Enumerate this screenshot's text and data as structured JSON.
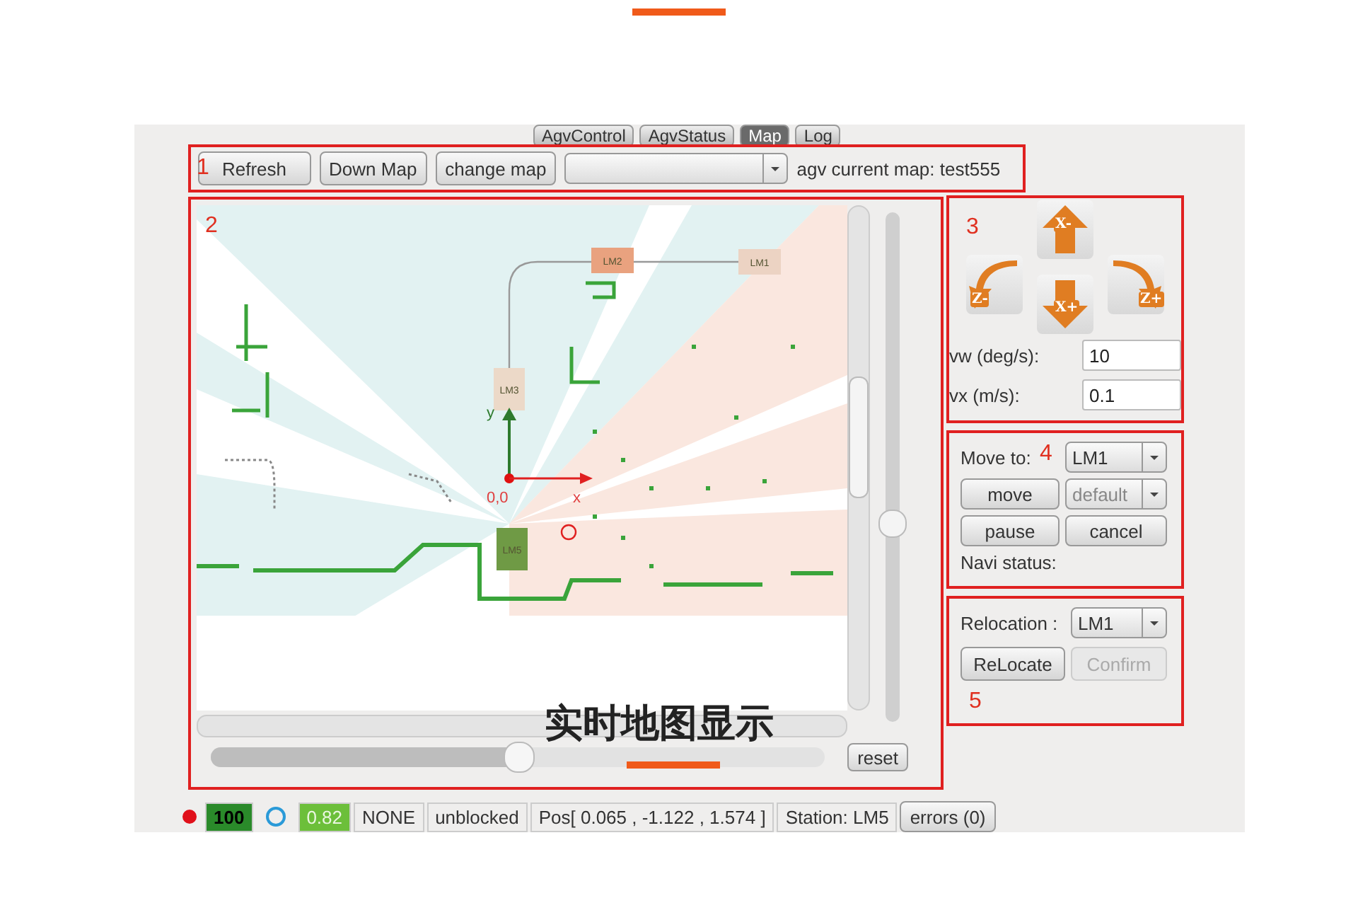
{
  "tabs": [
    {
      "label": "AgvControl",
      "selected": false
    },
    {
      "label": "AgvStatus",
      "selected": false
    },
    {
      "label": "Map",
      "selected": true
    },
    {
      "label": "Log",
      "selected": false
    }
  ],
  "toolbar": {
    "marker": "1",
    "buttons": [
      "Refresh",
      "Down Map",
      "change map"
    ],
    "current_map_label": "agv current map:",
    "current_map": "test555"
  },
  "map_view": {
    "marker": "2",
    "origin_label": "0,0",
    "x_axis": "x",
    "y_axis": "y",
    "landmarks": [
      {
        "label": "LM2",
        "color": "#e9a27f"
      },
      {
        "label": "LM1",
        "color": "#ecd3c3"
      },
      {
        "label": "LM3",
        "color": "#ecd9c8"
      },
      {
        "label": "LM5",
        "color": "#6f9a45"
      }
    ],
    "h_zoom": {
      "level": 0.5
    },
    "v_zoom": {
      "level": 0.39
    },
    "reset": "reset"
  },
  "manual_control": {
    "marker": "3",
    "buttons": [
      {
        "label": "Z-",
        "kind": "turn_left"
      },
      {
        "label": "X-",
        "kind": "up"
      },
      {
        "label": "X+",
        "kind": "down"
      },
      {
        "label": "Z+",
        "kind": "turn_right"
      }
    ],
    "fields": [
      {
        "label": "vw (deg/s):",
        "value": "10"
      },
      {
        "label": "vx (m/s):",
        "value": "0.1"
      }
    ]
  },
  "navigation": {
    "marker": "4",
    "move_to_label": "Move to:",
    "target": "LM1",
    "mode": {
      "value": "default",
      "disabled": true
    },
    "buttons": [
      "move",
      "pause",
      "cancel"
    ],
    "status_label": "Navi status:"
  },
  "relocation": {
    "marker": "5",
    "label": "Relocation :",
    "target": "LM1",
    "buttons": [
      {
        "label": "ReLocate",
        "disabled": false
      },
      {
        "label": "Confirm",
        "disabled": true
      }
    ]
  },
  "status_bar": {
    "battery": "100",
    "confidence": "0.82",
    "mode": "NONE",
    "blocked": "unblocked",
    "pos": "Pos[ 0.065 , -1.122 , 1.574 ]",
    "station": "Station: LM5",
    "errors": "errors (0)"
  },
  "caption": "实时地图显示"
}
